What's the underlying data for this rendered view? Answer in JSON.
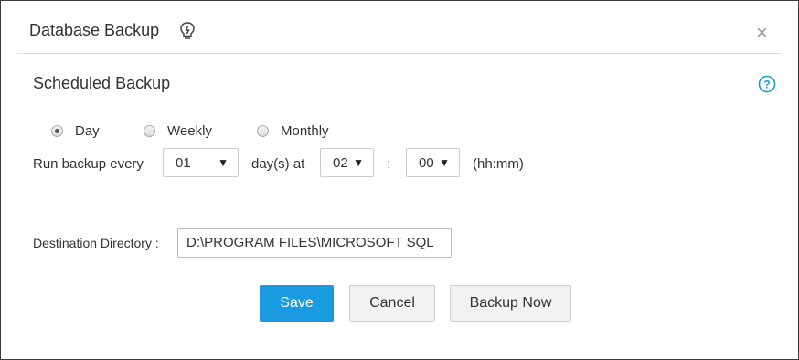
{
  "dialog": {
    "title": "Database Backup",
    "title_icon": "lightbulb-icon",
    "close_icon": "close-icon",
    "close_glyph": "×"
  },
  "schedule": {
    "heading": "Scheduled Backup",
    "help_icon": "question-circle-icon",
    "frequency_options": [
      {
        "label": "Day",
        "selected": true
      },
      {
        "label": "Weekly",
        "selected": false
      },
      {
        "label": "Monthly",
        "selected": false
      }
    ],
    "run_every_label": "Run backup every",
    "days_value": "01",
    "days_unit_label": "day(s) at",
    "hour_value": "02",
    "time_separator": ":",
    "minute_value": "00",
    "time_format_label": "(hh:mm)",
    "dropdown_arrow": "▼"
  },
  "destination": {
    "label": "Destination Directory :",
    "value": "D:\\PROGRAM FILES\\MICROSOFT SQL"
  },
  "buttons": {
    "save": "Save",
    "cancel": "Cancel",
    "backup_now": "Backup Now"
  },
  "colors": {
    "primary": "#1a9be0",
    "help_icon": "#1a9be0"
  }
}
